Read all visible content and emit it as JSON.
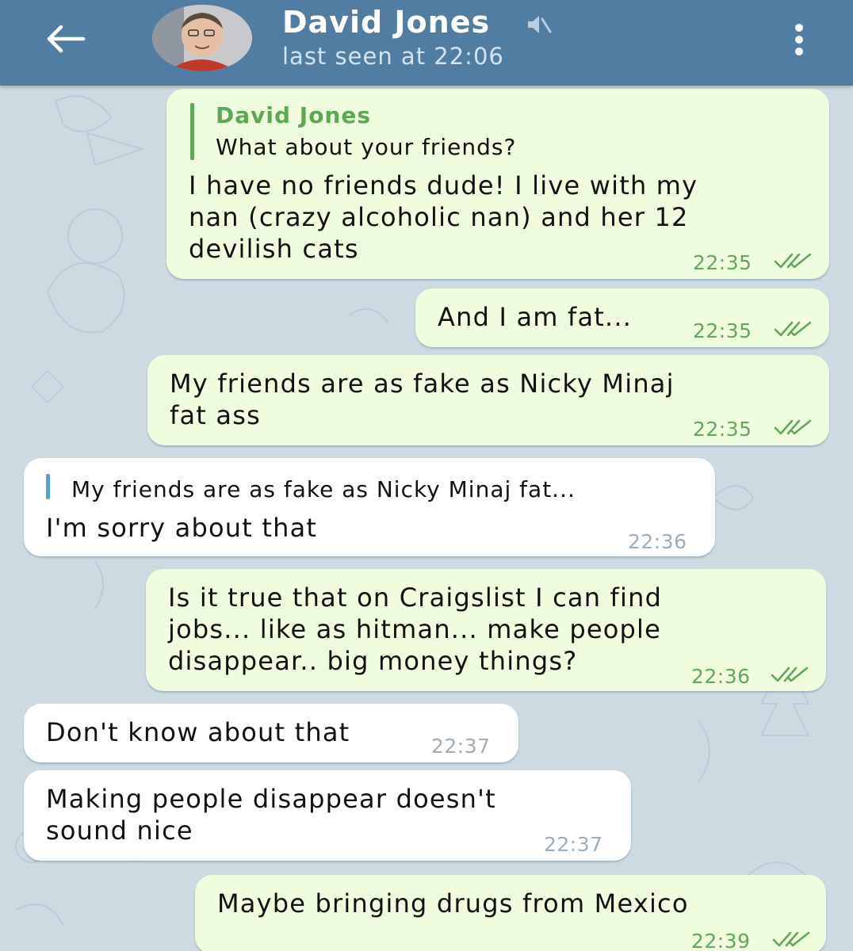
{
  "header": {
    "contact_name": "David Jones",
    "status": "last seen at 22:06",
    "icons": [
      "back-arrow-icon",
      "muted-icon",
      "more-vertical-icon"
    ]
  },
  "colors": {
    "header_bg": "#527da3",
    "chat_bg": "#cddae2",
    "outgoing_bubble": "#effdde",
    "incoming_bubble": "#ffffff",
    "outgoing_time": "#62a85a",
    "reply_name": "#5ea754",
    "incoming_reply_bar": "#5b9bd6"
  },
  "messages": [
    {
      "direction": "out",
      "reply": {
        "name": "David Jones",
        "text": "What about your friends?"
      },
      "text": "I have no friends dude! I live with my\nnan (crazy alcoholic nan) and her 12\ndevilish cats",
      "time": "22:35",
      "read": true
    },
    {
      "direction": "out",
      "text": "And I am fat...",
      "time": "22:35",
      "read": true
    },
    {
      "direction": "out",
      "text": "My friends are as fake as Nicky Minaj\nfat ass",
      "time": "22:35",
      "read": true
    },
    {
      "direction": "in",
      "reply": {
        "text": "My friends are as fake as Nicky Minaj fat..."
      },
      "text": "I'm sorry about that",
      "time": "22:36"
    },
    {
      "direction": "out",
      "text": "Is it true that on Craigslist I can find\njobs... like as hitman... make people\ndisappear.. big money things?",
      "time": "22:36",
      "read": true
    },
    {
      "direction": "in",
      "text": "Don't know about that",
      "time": "22:37"
    },
    {
      "direction": "in",
      "text": "Making people disappear doesn't\nsound nice",
      "time": "22:37"
    },
    {
      "direction": "out",
      "text": "Maybe bringing drugs from Mexico",
      "time": "22:39",
      "read": true
    }
  ]
}
